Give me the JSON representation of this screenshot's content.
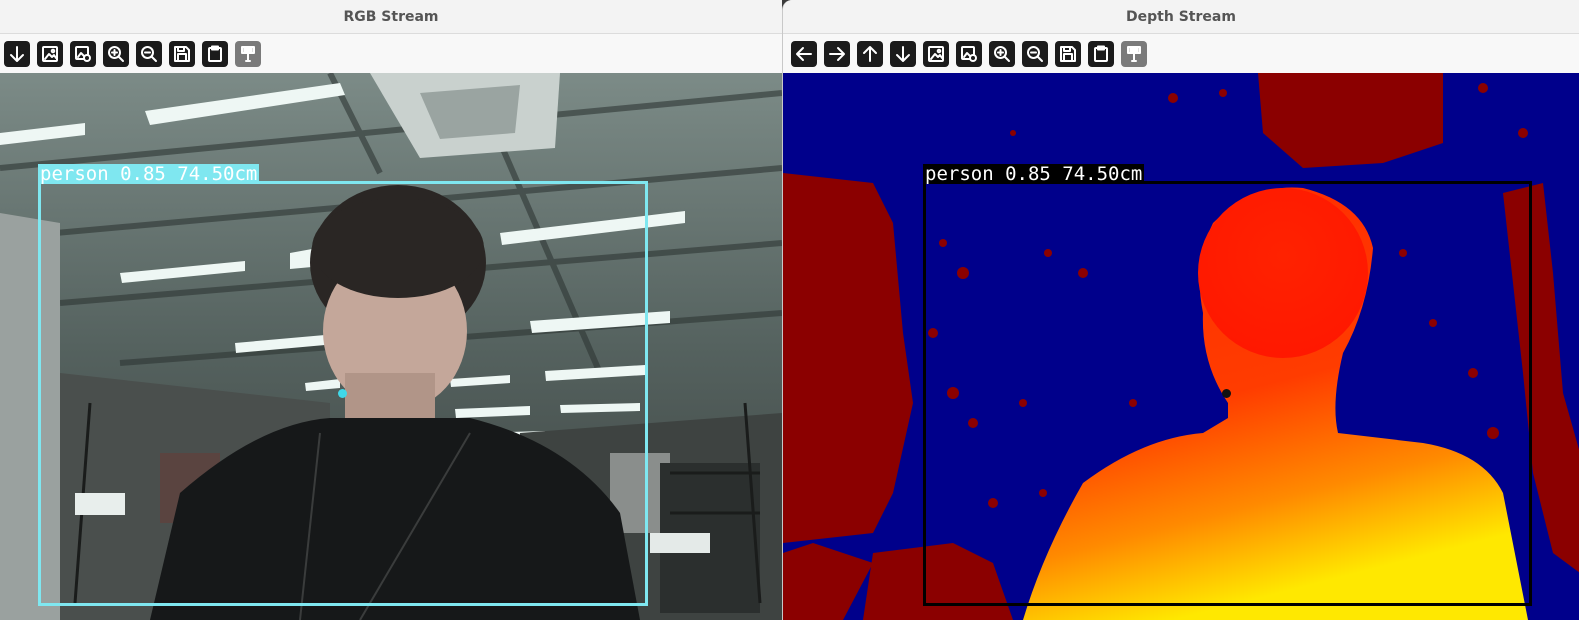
{
  "rgb_window": {
    "title": "RGB Stream",
    "toolbar": [
      {
        "icon": "arrow-down-icon",
        "enabled": true
      },
      {
        "icon": "image-icon",
        "enabled": true
      },
      {
        "icon": "image-settings-icon",
        "enabled": true
      },
      {
        "icon": "zoom-in-icon",
        "enabled": true
      },
      {
        "icon": "zoom-out-icon",
        "enabled": true
      },
      {
        "icon": "save-icon",
        "enabled": true
      },
      {
        "icon": "clipboard-icon",
        "enabled": true
      },
      {
        "icon": "properties-icon",
        "enabled": false
      }
    ],
    "detection": {
      "label": "person 0.85 74.50cm",
      "color": "#7fe7f0"
    }
  },
  "depth_window": {
    "title": "Depth Stream",
    "toolbar": [
      {
        "icon": "arrow-left-icon",
        "enabled": true
      },
      {
        "icon": "arrow-right-icon",
        "enabled": true
      },
      {
        "icon": "arrow-up-icon",
        "enabled": true
      },
      {
        "icon": "arrow-down-icon",
        "enabled": true
      },
      {
        "icon": "image-icon",
        "enabled": true
      },
      {
        "icon": "image-settings-icon",
        "enabled": true
      },
      {
        "icon": "zoom-in-icon",
        "enabled": true
      },
      {
        "icon": "zoom-out-icon",
        "enabled": true
      },
      {
        "icon": "save-icon",
        "enabled": true
      },
      {
        "icon": "clipboard-icon",
        "enabled": true
      },
      {
        "icon": "properties-icon",
        "enabled": false
      }
    ],
    "detection": {
      "label": "person 0.85 74.50cm",
      "color": "#000000"
    }
  },
  "colors": {
    "depth_background": "#00008b",
    "depth_far": "#8b0000",
    "depth_near": "#ff2000",
    "depth_nearest": "#ffe000"
  }
}
